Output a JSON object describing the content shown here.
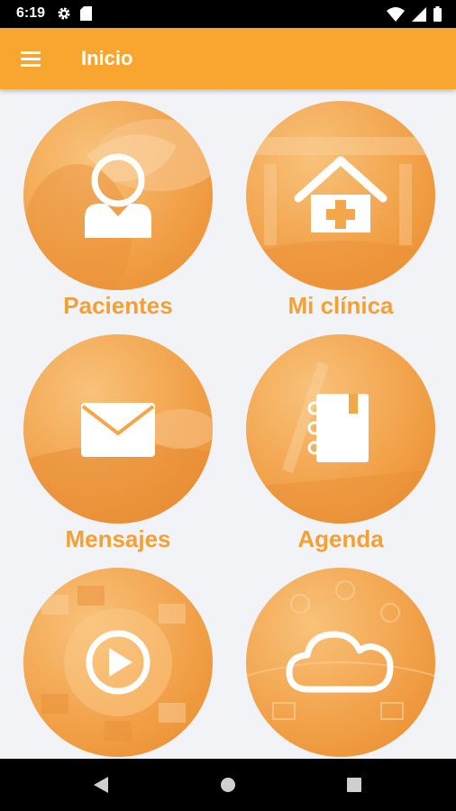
{
  "status_bar": {
    "time": "6:19",
    "icons": [
      "gear-icon",
      "sd-card-icon",
      "wifi-icon",
      "signal-icon",
      "battery-icon"
    ]
  },
  "app_bar": {
    "title": "Inicio",
    "menu_icon": "hamburger-menu-icon",
    "color": "#f9a630"
  },
  "menu_tiles": [
    {
      "label": "Pacientes",
      "icon": "patient-icon"
    },
    {
      "label": "Mi clínica",
      "icon": "clinic-house-icon"
    },
    {
      "label": "Mensajes",
      "icon": "envelope-icon"
    },
    {
      "label": "Agenda",
      "icon": "notebook-icon"
    },
    {
      "label": "",
      "icon": "play-video-icon"
    },
    {
      "label": "",
      "icon": "cloud-icon"
    }
  ],
  "nav_bar": {
    "buttons": [
      "back-icon",
      "home-icon",
      "recents-icon"
    ]
  },
  "colors": {
    "accent": "#f9a630",
    "label": "#f5a033",
    "background": "#f2f3f7"
  }
}
